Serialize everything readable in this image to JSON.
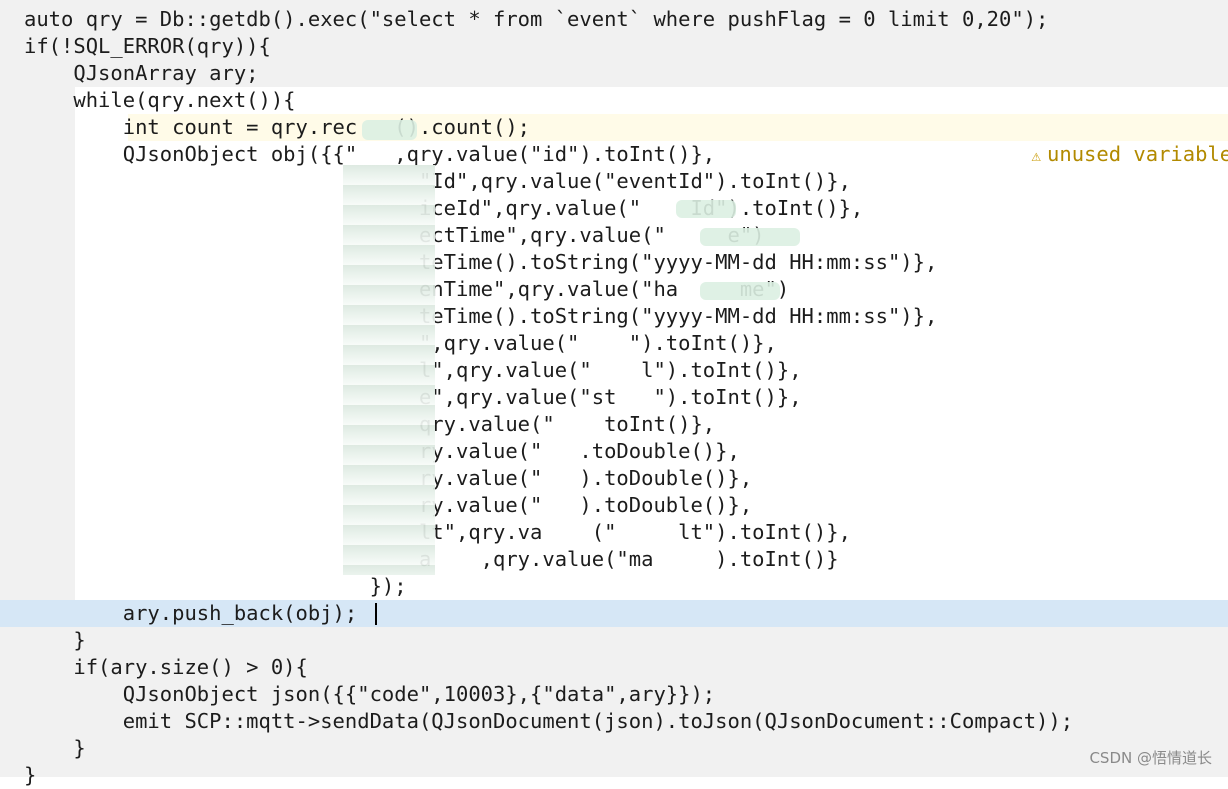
{
  "lines": [
    "auto qry = Db::getdb().exec(\"select * from `event` where pushFlag = 0 limit 0,20\");",
    "if(!SQL_ERROR(qry)){",
    "    QJsonArray ary;",
    "    while(qry.next()){",
    "        int count = qry.rec   ().count();",
    "        QJsonObject obj({{\"   ,qry.value(\"id\").toInt()},",
    "                                \"Id\",qry.value(\"eventId\").toInt()},",
    "                                iceId\",qry.value(\"    Id\").toInt()},",
    "                                ectTime\",qry.value(\"     e\")",
    "                                teTime().toString(\"yyyy-MM-dd HH:mm:ss\")},",
    "                                enTime\",qry.value(\"ha     me\")",
    "                                teTime().toString(\"yyyy-MM-dd HH:mm:ss\")},",
    "                                \",qry.value(\"    \").toInt()},",
    "                                l\",qry.value(\"    l\").toInt()},",
    "                                e\",qry.value(\"st   \").toInt()},",
    "                                qry.value(\"    toInt()},",
    "                                ry.value(\"   .toDouble()},",
    "                                ry.value(\"   ).toDouble()},",
    "                                ry.value(\"   ).toDouble()},",
    "                                lt\",qry.va    (\"     lt\").toInt()},",
    "                                a    ,qry.value(\"ma     ).toInt()}",
    "                            });",
    "        ary.push_back(obj);",
    "    }",
    "    if(ary.size() > 0){",
    "        QJsonObject json({{\"code\",10003},{\"data\",ary}});",
    "        emit SCP::mqtt->sendData(QJsonDocument(json).toJson(QJsonDocument::Compact));",
    "    }",
    "}"
  ],
  "warning": {
    "icon": "warning-triangle-icon",
    "text": "unused variable 'c"
  },
  "watermark": "CSDN @悟情道长",
  "colors": {
    "keyword": "#808000",
    "type": "#800080",
    "function": "#00677c",
    "string": "#008000",
    "current_line": "#d6e7f6"
  }
}
